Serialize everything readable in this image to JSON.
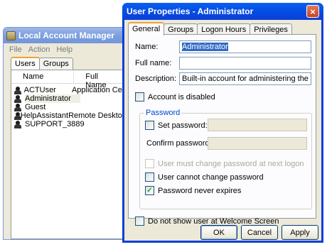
{
  "background_window": {
    "title": "Local Account Manager",
    "menu": [
      "File",
      "Action",
      "Help"
    ],
    "tabs": [
      "Users",
      "Groups"
    ],
    "columns": [
      "Name",
      "Full Name"
    ],
    "users": [
      {
        "name": "ACTUser",
        "full_name": "Application Cen"
      },
      {
        "name": "Administrator",
        "full_name": ""
      },
      {
        "name": "Guest",
        "full_name": ""
      },
      {
        "name": "HelpAssistant",
        "full_name": "Remote Desktop"
      },
      {
        "name": "SUPPORT_3889",
        "full_name": ""
      }
    ]
  },
  "dialog": {
    "title": "User Properties - Administrator",
    "close_icon": "×",
    "tabs": [
      "General",
      "Groups",
      "Logon Hours",
      "Privileges"
    ],
    "name_label": "Name:",
    "name_value": "Administrator",
    "fullname_label": "Full name:",
    "fullname_value": "",
    "description_label": "Description:",
    "description_value": "Built-in account for administering the computer/domain",
    "account_disabled_label": "Account is disabled",
    "password_group_label": "Password",
    "set_password_label": "Set password:",
    "confirm_password_label": "Confirm password:",
    "must_change_label": "User must change password at next logon",
    "cannot_change_label": "User cannot change password",
    "never_expires_label": "Password never expires",
    "hide_welcome_label": "Do not show user at Welcome Screen",
    "ok_label": "OK",
    "cancel_label": "Cancel",
    "apply_label": "Apply",
    "check_mark": "✓"
  }
}
